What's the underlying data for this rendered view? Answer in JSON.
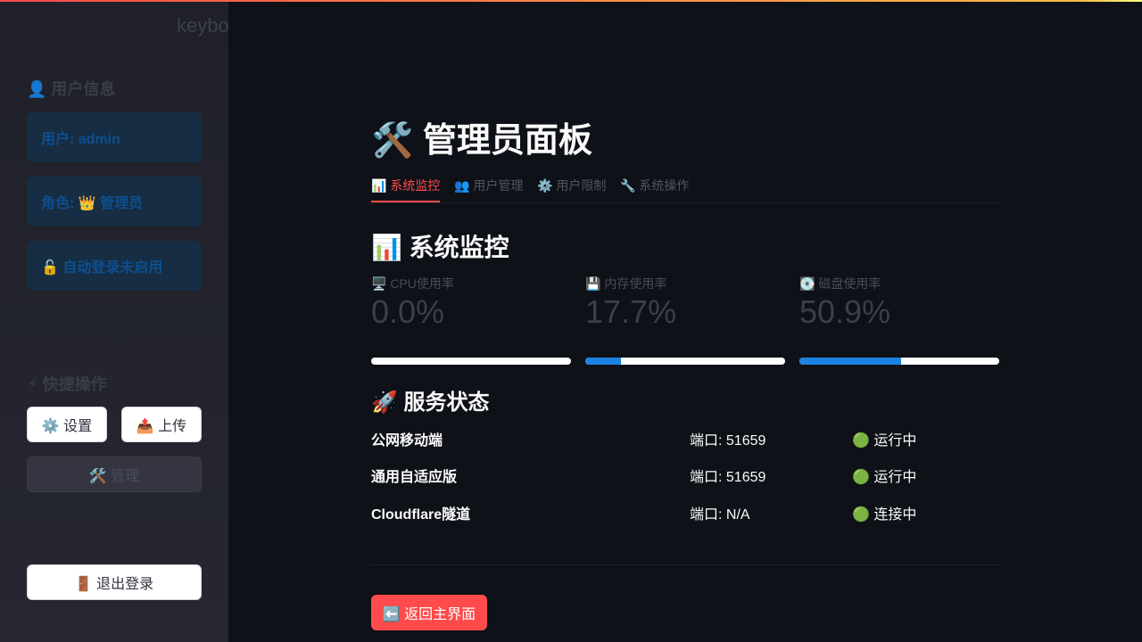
{
  "sidebar": {
    "ghost_text": "keybo",
    "user_info_heading": "👤 用户信息",
    "cards": [
      {
        "text": "用户: admin"
      },
      {
        "text": "角色: 👑 管理员"
      },
      {
        "text": "🔓 自动登录未启用"
      }
    ],
    "quick_actions_heading": "⚡ 快捷操作",
    "settings_button": "⚙️ 设置",
    "upload_button": "📤 上传",
    "admin_button": "🛠️ 管理",
    "logout_button": "🚪 退出登录"
  },
  "main": {
    "title": "🛠️ 管理员面板",
    "tabs": [
      {
        "label": "📊 系统监控",
        "active": true
      },
      {
        "label": "👥 用户管理",
        "active": false
      },
      {
        "label": "⚙️ 用户限制",
        "active": false
      },
      {
        "label": "🔧 系统操作",
        "active": false
      }
    ],
    "monitor_title": "📊 系统监控",
    "metrics": [
      {
        "label": "🖥️ CPU使用率",
        "value": "0.0%",
        "progress": 0.0
      },
      {
        "label": "💾 内存使用率",
        "value": "17.7%",
        "progress": 0.177
      },
      {
        "label": "💽 磁盘使用率",
        "value": "50.9%",
        "progress": 0.509
      }
    ],
    "services_title": "🚀 服务状态",
    "services": [
      {
        "name": "公网移动端",
        "port": "端口: 51659",
        "status": "🟢 运行中"
      },
      {
        "name": "通用自适应版",
        "port": "端口: 51659",
        "status": "🟢 运行中"
      },
      {
        "name": "Cloudflare隧道",
        "port": "端口: N/A",
        "status": "🟢 连接中"
      }
    ],
    "back_button": "⬅️ 返回主界面"
  },
  "colors": {
    "accent": "#ff4b4b",
    "progress_fill": "#1c83e1",
    "background": "#0e1117"
  }
}
